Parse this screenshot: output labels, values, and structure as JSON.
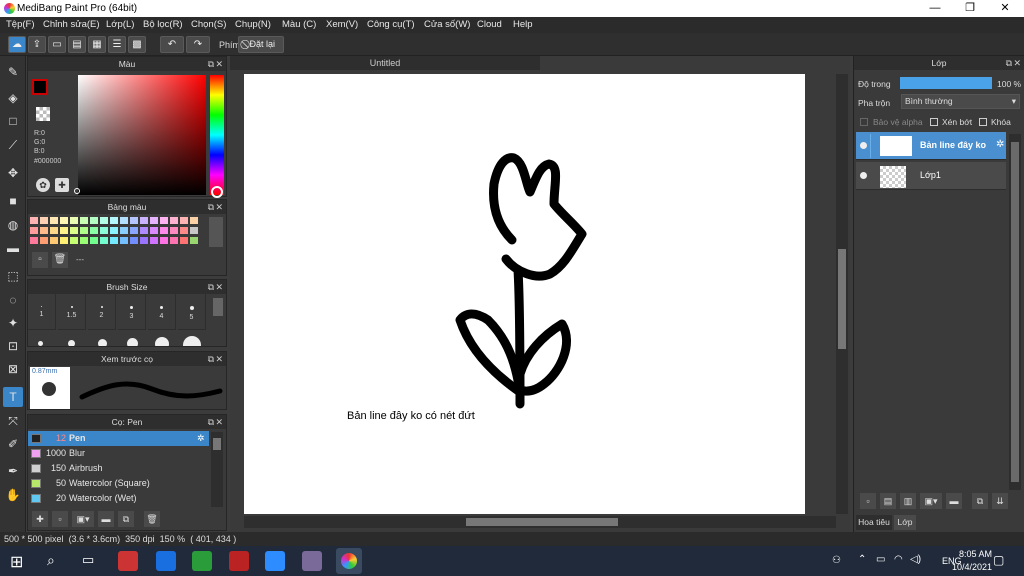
{
  "window": {
    "title": "MediBang Paint Pro (64bit)",
    "minimize": "—",
    "maximize": "❐",
    "close": "✕"
  },
  "menu": [
    "Tệp(F)",
    "Chỉnh sửa(E)",
    "Lớp(L)",
    "Bộ lọc(R)",
    "Chọn(S)",
    "Chụp(N)",
    "Màu (C)",
    "Xem(V)",
    "Công cụ(T)",
    "Cửa số(W)",
    "Cloud",
    "Help"
  ],
  "toolbar": {
    "shortcut_label": "Phím",
    "reset_label": "Đặt lại"
  },
  "color_panel": {
    "title": "Màu",
    "r": "R:0",
    "g": "G:0",
    "b": "B:0",
    "hex": "#000000",
    "foreground": "#000000",
    "background": "#d070e0"
  },
  "palette_panel": {
    "title": "Bảng màu",
    "rows": [
      [
        "#ffb3b3",
        "#ffd1b3",
        "#ffe6b3",
        "#fff7b3",
        "#eaffb3",
        "#c9ffb3",
        "#b3ffc4",
        "#b3ffe6",
        "#b3f7ff",
        "#b3e0ff",
        "#b3c4ff",
        "#c9b3ff",
        "#e6b3ff",
        "#ffb3f2",
        "#ffb3d1",
        "#ffb3b3",
        "#fbd2a6"
      ],
      [
        "#ff9c9c",
        "#ffbb8a",
        "#ffd98a",
        "#fff38a",
        "#dcff8a",
        "#b0ff8a",
        "#8affa6",
        "#8affd9",
        "#8af3ff",
        "#8ad0ff",
        "#8aa6ff",
        "#b08aff",
        "#d98aff",
        "#ff8aeb",
        "#ff8ac0",
        "#ff8a8a",
        "#c7c7c7"
      ],
      [
        "#ff7a9a",
        "#ff9e73",
        "#ffc973",
        "#ffef73",
        "#c7ff73",
        "#9aff73",
        "#73ff8e",
        "#73ffcf",
        "#73eaff",
        "#73bfff",
        "#738eff",
        "#9a73ff",
        "#cf73ff",
        "#ff73e4",
        "#ff73b0",
        "#ff7373",
        "#9ad66f"
      ]
    ],
    "divider_text": "---"
  },
  "brush_size_panel": {
    "title": "Brush Size",
    "sizes": [
      "1",
      "1.5",
      "2",
      "3",
      "4",
      "5"
    ]
  },
  "brush_preview_panel": {
    "title": "Xem trước cọ",
    "size_label": "0.87mm"
  },
  "brush_panel": {
    "title": "Cọ: Pen",
    "items": [
      {
        "size": "12",
        "name": "Pen",
        "color": "#222222"
      },
      {
        "size": "1000",
        "name": "Blur",
        "color": "#f0a0f0"
      },
      {
        "size": "150",
        "name": "Airbrush",
        "color": "#d0d0d0"
      },
      {
        "size": "50",
        "name": "Watercolor (Square)",
        "color": "#b8e86a"
      },
      {
        "size": "20",
        "name": "Watercolor (Wet)",
        "color": "#60c8f0"
      }
    ]
  },
  "canvas": {
    "tab_title": "Untitled",
    "caption": "Bản line đây ko có nét đứt"
  },
  "layer_panel": {
    "title": "Lớp",
    "opacity_label": "Độ trong",
    "opacity_value": "100 %",
    "opacity_level": 1.0,
    "blend_label": "Pha trộn",
    "blend_value": "Bình thường",
    "protect_alpha": "Bảo vệ alpha",
    "clip": "Xén bớt",
    "lock": "Khóa",
    "layers": [
      {
        "name": "Bản line đây ko"
      },
      {
        "name": "Lớp1"
      }
    ],
    "tab_navigator": "Hoa tiêu",
    "tab_layer": "Lớp"
  },
  "status": {
    "size": "500 * 500 pixel",
    "cm": "(3.6 * 3.6cm)",
    "dpi": "350 dpi",
    "zoom": "150 %",
    "coords": "( 401, 434 )"
  },
  "taskbar": {
    "time": "8:05 AM",
    "date": "10/4/2021",
    "lang": "ENG"
  }
}
